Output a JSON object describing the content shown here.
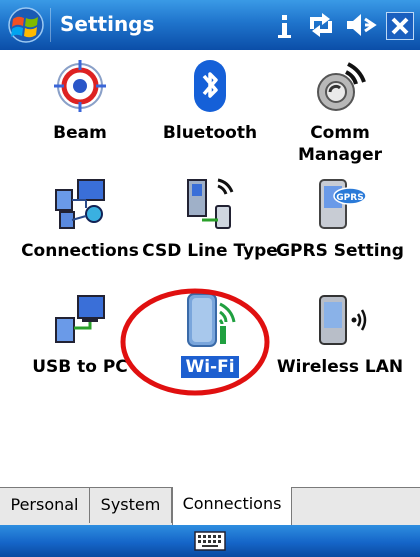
{
  "titlebar": {
    "title": "Settings",
    "icons": [
      "windows-start-icon",
      "connectivity-icon",
      "sync-icon",
      "volume-icon",
      "close-icon"
    ]
  },
  "items": [
    {
      "label": "Beam",
      "icon": "beam-icon"
    },
    {
      "label": "Bluetooth",
      "icon": "bluetooth-icon"
    },
    {
      "label": "Comm Manager",
      "icon": "comm-manager-icon"
    },
    {
      "label": "Connections",
      "icon": "connections-icon"
    },
    {
      "label": "CSD Line Type",
      "icon": "csd-line-type-icon"
    },
    {
      "label": "GPRS Setting",
      "icon": "gprs-icon"
    },
    {
      "label": "USB to PC",
      "icon": "usb-to-pc-icon"
    },
    {
      "label": "Wi-Fi",
      "icon": "wifi-icon",
      "selected": true
    },
    {
      "label": "Wireless LAN",
      "icon": "wireless-lan-icon"
    }
  ],
  "tabs": [
    {
      "label": "Personal"
    },
    {
      "label": "System"
    },
    {
      "label": "Connections",
      "active": true
    }
  ],
  "bottombar": {
    "icon": "keyboard-icon"
  },
  "colors": {
    "titlebar": "#1f74cc",
    "selection": "#1d5fd0",
    "highlight_ring": "#e01010"
  }
}
